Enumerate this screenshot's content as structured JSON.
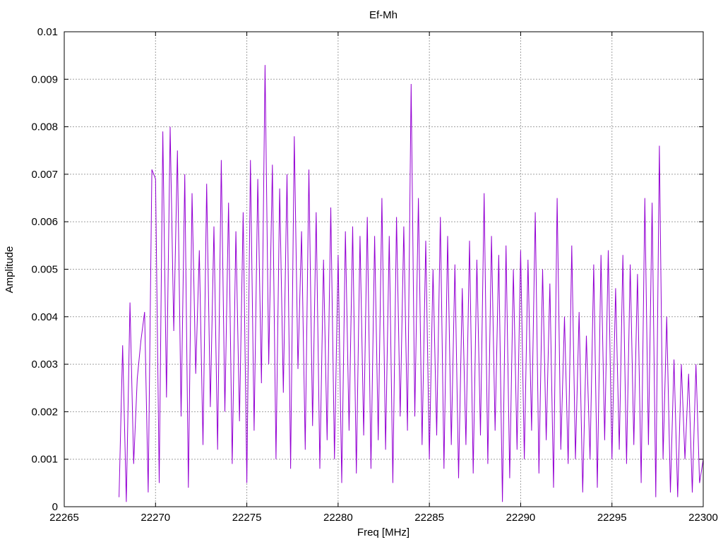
{
  "chart_data": {
    "type": "line",
    "title": "Ef-Mh",
    "xlabel": "Freq [MHz]",
    "ylabel": "Amplitude",
    "xlim": [
      22265,
      22300
    ],
    "ylim": [
      0,
      0.01
    ],
    "xticks": [
      "22265",
      "22270",
      "22275",
      "22280",
      "22285",
      "22290",
      "22295",
      "22300"
    ],
    "yticks": [
      "0",
      "0.001",
      "0.002",
      "0.003",
      "0.004",
      "0.005",
      "0.006",
      "0.007",
      "0.008",
      "0.009",
      "0.01"
    ],
    "grid": true,
    "series": [
      {
        "color": "#9400d3",
        "x": [
          22268.0,
          22268.2,
          22268.4,
          22268.6,
          22268.8,
          22269.0,
          22269.2,
          22269.4,
          22269.6,
          22269.8,
          22270.0,
          22270.2,
          22270.4,
          22270.6,
          22270.8,
          22271.0,
          22271.2,
          22271.4,
          22271.6,
          22271.8,
          22272.0,
          22272.2,
          22272.4,
          22272.6,
          22272.8,
          22273.0,
          22273.2,
          22273.4,
          22273.6,
          22273.8,
          22274.0,
          22274.2,
          22274.4,
          22274.6,
          22274.8,
          22275.0,
          22275.2,
          22275.4,
          22275.6,
          22275.8,
          22276.0,
          22276.2,
          22276.4,
          22276.6,
          22276.8,
          22277.0,
          22277.2,
          22277.4,
          22277.6,
          22277.8,
          22278.0,
          22278.2,
          22278.4,
          22278.6,
          22278.8,
          22279.0,
          22279.2,
          22279.4,
          22279.6,
          22279.8,
          22280.0,
          22280.2,
          22280.4,
          22280.6,
          22280.8,
          22281.0,
          22281.2,
          22281.4,
          22281.6,
          22281.8,
          22282.0,
          22282.2,
          22282.4,
          22282.6,
          22282.8,
          22283.0,
          22283.2,
          22283.4,
          22283.6,
          22283.8,
          22284.0,
          22284.2,
          22284.4,
          22284.6,
          22284.8,
          22285.0,
          22285.2,
          22285.4,
          22285.6,
          22285.8,
          22286.0,
          22286.2,
          22286.4,
          22286.6,
          22286.8,
          22287.0,
          22287.2,
          22287.4,
          22287.6,
          22287.8,
          22288.0,
          22288.2,
          22288.4,
          22288.6,
          22288.8,
          22289.0,
          22289.2,
          22289.4,
          22289.6,
          22289.8,
          22290.0,
          22290.2,
          22290.4,
          22290.6,
          22290.8,
          22291.0,
          22291.2,
          22291.4,
          22291.6,
          22291.8,
          22292.0,
          22292.2,
          22292.4,
          22292.6,
          22292.8,
          22293.0,
          22293.2,
          22293.4,
          22293.6,
          22293.8,
          22294.0,
          22294.2,
          22294.4,
          22294.6,
          22294.8,
          22295.0,
          22295.2,
          22295.4,
          22295.6,
          22295.8,
          22296.0,
          22296.2,
          22296.4,
          22296.6,
          22296.8,
          22297.0,
          22297.2,
          22297.4,
          22297.6,
          22297.8,
          22298.0,
          22298.2,
          22298.4,
          22298.6,
          22298.8,
          22299.0,
          22299.2,
          22299.4,
          22299.6,
          22299.8,
          22300.0
        ],
        "y": [
          0.0002,
          0.0034,
          0.0001,
          0.0043,
          0.0009,
          0.0027,
          0.0035,
          0.0041,
          0.0003,
          0.0071,
          0.0069,
          0.0005,
          0.0079,
          0.0023,
          0.008,
          0.0037,
          0.0075,
          0.0019,
          0.007,
          0.0004,
          0.0066,
          0.0028,
          0.0054,
          0.0013,
          0.0068,
          0.0021,
          0.0059,
          0.0012,
          0.0073,
          0.002,
          0.0064,
          0.0009,
          0.0058,
          0.0018,
          0.0062,
          0.0005,
          0.0073,
          0.0016,
          0.0069,
          0.0026,
          0.0093,
          0.003,
          0.0072,
          0.001,
          0.0067,
          0.0024,
          0.007,
          0.0008,
          0.0078,
          0.0029,
          0.0058,
          0.0012,
          0.0071,
          0.0017,
          0.0062,
          0.0008,
          0.0052,
          0.0014,
          0.0063,
          0.001,
          0.0053,
          0.0005,
          0.0058,
          0.0016,
          0.0059,
          0.0007,
          0.0057,
          0.0015,
          0.0061,
          0.0008,
          0.0057,
          0.0014,
          0.0065,
          0.0012,
          0.0057,
          0.0005,
          0.0061,
          0.0019,
          0.0059,
          0.0016,
          0.0089,
          0.0019,
          0.0065,
          0.0013,
          0.0056,
          0.001,
          0.005,
          0.0015,
          0.0061,
          0.0008,
          0.0057,
          0.0013,
          0.0051,
          0.0006,
          0.0046,
          0.0013,
          0.0056,
          0.0007,
          0.0052,
          0.0015,
          0.0066,
          0.0009,
          0.0057,
          0.0016,
          0.0053,
          0.0001,
          0.0055,
          0.0006,
          0.005,
          0.0012,
          0.0054,
          0.001,
          0.0052,
          0.0016,
          0.0062,
          0.0007,
          0.005,
          0.0014,
          0.0047,
          0.0004,
          0.0065,
          0.0012,
          0.004,
          0.0009,
          0.0055,
          0.001,
          0.0041,
          0.0003,
          0.0036,
          0.001,
          0.0051,
          0.0004,
          0.0053,
          0.0014,
          0.0054,
          0.001,
          0.0046,
          0.0012,
          0.0053,
          0.0009,
          0.0051,
          0.0013,
          0.0049,
          0.0005,
          0.0065,
          0.0013,
          0.0064,
          0.0002,
          0.0076,
          0.001,
          0.004,
          0.0003,
          0.0031,
          0.0002,
          0.003,
          0.001,
          0.0028,
          0.0003,
          0.003,
          0.0005,
          0.001
        ]
      }
    ]
  }
}
